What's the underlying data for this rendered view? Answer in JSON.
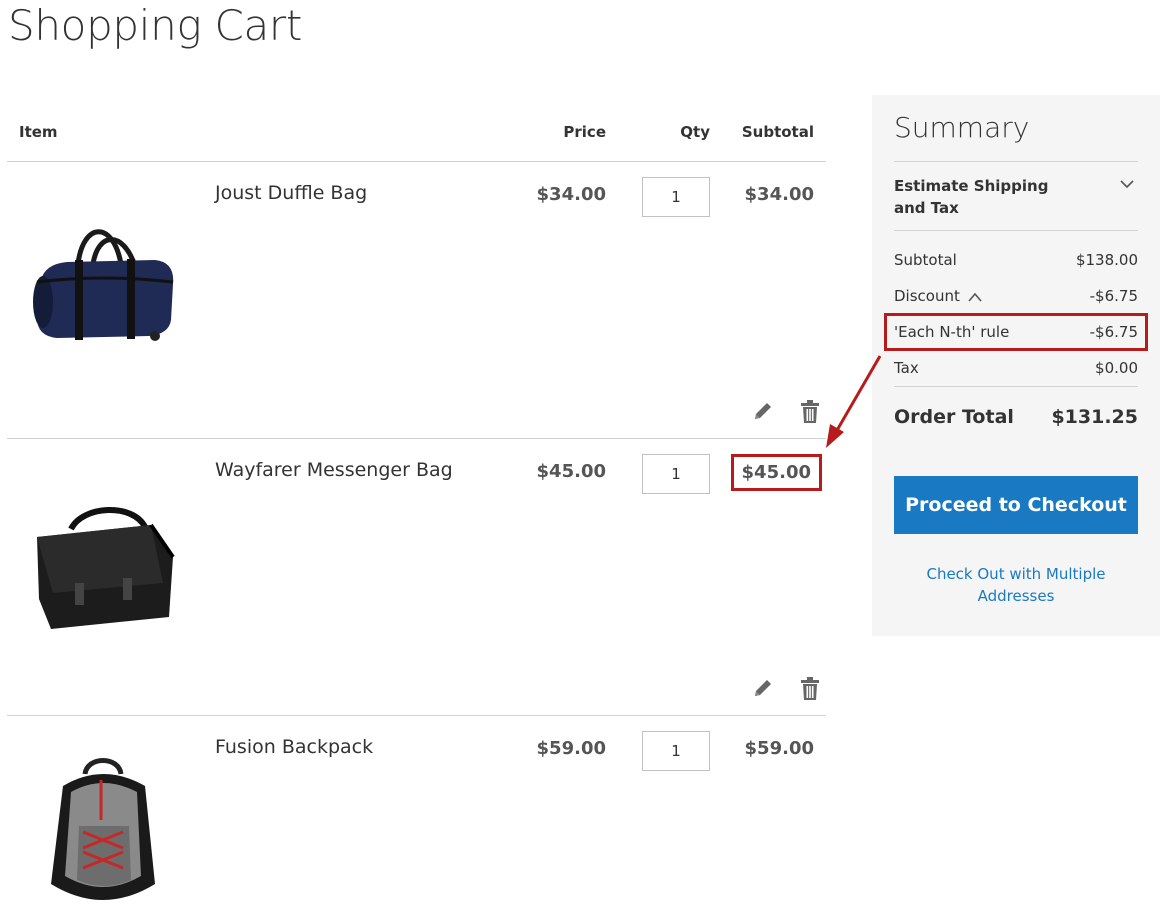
{
  "page": {
    "title": "Shopping Cart"
  },
  "cart": {
    "headers": {
      "item": "Item",
      "price": "Price",
      "qty": "Qty",
      "subtotal": "Subtotal"
    },
    "items": [
      {
        "name": "Joust Duffle Bag",
        "price": "$34.00",
        "qty": "1",
        "subtotal": "$34.00",
        "image": "duffle-bag"
      },
      {
        "name": "Wayfarer Messenger Bag",
        "price": "$45.00",
        "qty": "1",
        "subtotal": "$45.00",
        "image": "messenger-bag"
      },
      {
        "name": "Fusion Backpack",
        "price": "$59.00",
        "qty": "1",
        "subtotal": "$59.00",
        "image": "backpack"
      }
    ],
    "icons": {
      "edit": "pencil-icon",
      "delete": "trash-icon"
    }
  },
  "summary": {
    "title": "Summary",
    "estimate_label": "Estimate Shipping and Tax",
    "subtotal_label": "Subtotal",
    "subtotal_value": "$138.00",
    "discount_label": "Discount",
    "discount_value": "-$6.75",
    "rule_label": "'Each N-th' rule",
    "rule_value": "-$6.75",
    "tax_label": "Tax",
    "tax_value": "$0.00",
    "total_label": "Order Total",
    "total_value": "$131.25",
    "checkout_label": "Proceed to Checkout",
    "multi_label": "Check Out with Multiple Addresses"
  },
  "colors": {
    "accent": "#1979c3",
    "highlight": "#b71c1c",
    "summary_bg": "#f5f5f5"
  }
}
